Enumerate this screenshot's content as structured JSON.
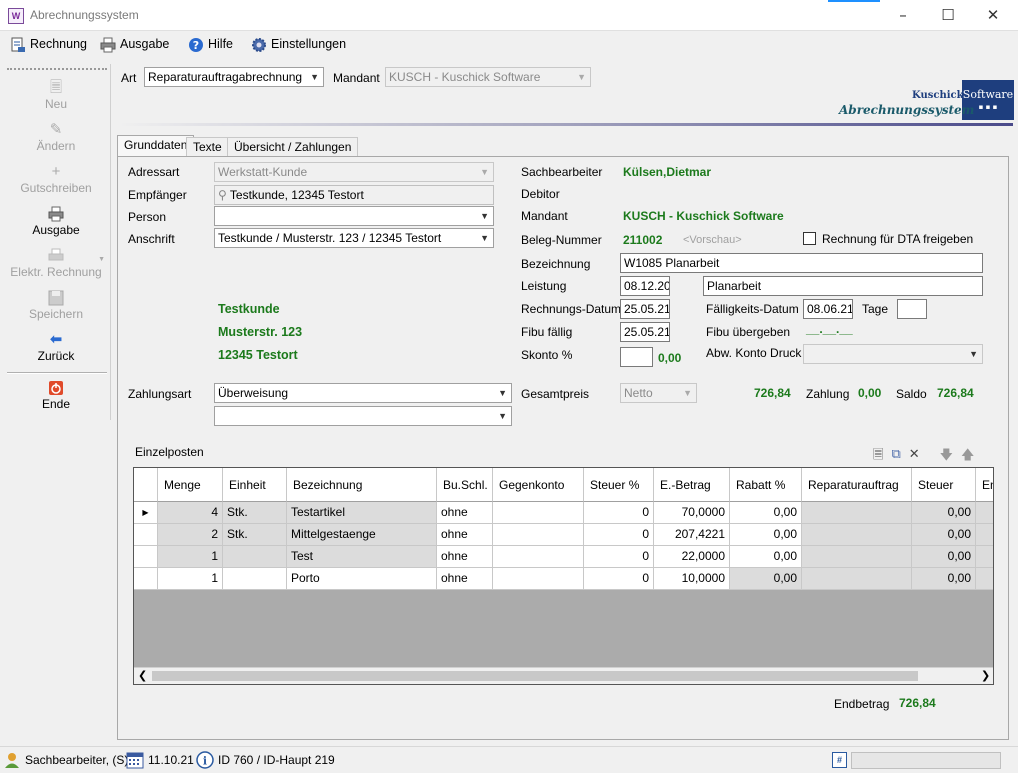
{
  "window": {
    "title": "Abrechnungssystem",
    "app_icon_text": "W"
  },
  "menu": [
    {
      "label": "Rechnung"
    },
    {
      "label": "Ausgabe"
    },
    {
      "label": "Hilfe"
    },
    {
      "label": "Einstellungen"
    }
  ],
  "nav": [
    {
      "label": "Neu",
      "enabled": false
    },
    {
      "label": "Ändern",
      "enabled": false
    },
    {
      "label": "Gutschreiben",
      "enabled": false
    },
    {
      "label": "Ausgabe",
      "enabled": true
    },
    {
      "label": "Elektr. Rechnung",
      "enabled": false
    },
    {
      "label": "Speichern",
      "enabled": false
    },
    {
      "label": "Zurück",
      "enabled": true
    },
    {
      "label": "Ende",
      "enabled": true
    }
  ],
  "top": {
    "art_label": "Art",
    "art_value": "Reparaturauftragabrechnung",
    "mandant_label": "Mandant",
    "mandant_value": "KUSCH - Kuschick Software"
  },
  "logo": {
    "line1": "Kuschick",
    "box_text": "Software",
    "box_dots": "▪ ▪ ▪",
    "line2": "Abrechnungssystem"
  },
  "tabs": [
    {
      "label": "Grunddaten"
    },
    {
      "label": "Texte"
    },
    {
      "label": "Übersicht / Zahlungen"
    }
  ],
  "form": {
    "adressart_label": "Adressart",
    "adressart_value": "Werkstatt-Kunde",
    "empfaenger_label": "Empfänger",
    "empfaenger_value": "Testkunde, 12345 Testort",
    "person_label": "Person",
    "person_value": "",
    "anschrift_label": "Anschrift",
    "anschrift_value": "Testkunde / Musterstr. 123 / 12345 Testort",
    "address_lines": [
      "Testkunde",
      "Musterstr. 123",
      "12345 Testort"
    ],
    "zahlungsart_label": "Zahlungsart",
    "zahlungsart_value": "Überweisung",
    "zahlungsart2_value": "",
    "sachbearbeiter_label": "Sachbearbeiter",
    "sachbearbeiter_value": "Külsen,Dietmar",
    "debitor_label": "Debitor",
    "mandant_label": "Mandant",
    "mandant_value": "KUSCH - Kuschick Software",
    "beleg_label": "Beleg-Nummer",
    "beleg_value": "211002",
    "beleg_hint": "<Vorschau>",
    "dta_label": "Rechnung für DTA freigeben",
    "bezeichnung_label": "Bezeichnung",
    "bezeichnung_value": "W1085 Planarbeit",
    "leistung_label": "Leistung",
    "leistung_date": "08.12.20",
    "leistung_text": "Planarbeit",
    "rechnungsdatum_label": "Rechnungs-Datum",
    "rechnungsdatum_value": "25.05.21",
    "faelligkeit_label": "Fälligkeits-Datum",
    "faelligkeit_value": "08.06.21",
    "tage_label": "Tage",
    "tage_value": "",
    "fibu_faellig_label": "Fibu fällig",
    "fibu_faellig_value": "25.05.21",
    "fibu_uebergeben_label": "Fibu übergeben",
    "fibu_uebergeben_value": "__.__.__",
    "skonto_label": "Skonto %",
    "skonto_value": "",
    "skonto_amount": "0,00",
    "abw_konto_label": "Abw. Konto Druck",
    "abw_konto_value": "",
    "gesamtpreis_label": "Gesamtpreis",
    "gesamtpreis_mode": "Netto",
    "gesamtpreis_value": "726,84",
    "zahlung_label": "Zahlung",
    "zahlung_value": "0,00",
    "saldo_label": "Saldo",
    "saldo_value": "726,84",
    "einzelposten_label": "Einzelposten",
    "endbetrag_label": "Endbetrag",
    "endbetrag_value": "726,84"
  },
  "grid": {
    "headers": [
      "Menge",
      "Einheit",
      "Bezeichnung",
      "Bu.Schl.",
      "Gegenkonto",
      "Steuer %",
      "E.-Betrag",
      "Rabatt %",
      "Reparaturauftrag",
      "Steuer",
      "En"
    ],
    "rows": [
      [
        "4",
        "Stk.",
        "Testartikel",
        "ohne",
        "",
        "0",
        "70,0000",
        "0,00",
        "",
        "0,00"
      ],
      [
        "2",
        "Stk.",
        "Mittelgestaenge",
        "ohne",
        "",
        "0",
        "207,4221",
        "0,00",
        "",
        "0,00"
      ],
      [
        "1",
        "",
        "Test",
        "ohne",
        "",
        "0",
        "22,0000",
        "0,00",
        "",
        "0,00"
      ],
      [
        "1",
        "",
        "Porto",
        "ohne",
        "",
        "0",
        "10,0000",
        "0,00",
        "",
        "0,00"
      ]
    ]
  },
  "status": {
    "user": "Sachbearbeiter, (S)",
    "date": "11.10.21",
    "id": "ID 760 / ID-Haupt 219"
  },
  "colors": {
    "green_value": "#1c7a1c",
    "logo_blue": "#1e3e7e",
    "logo_teal": "#1a5a6a"
  }
}
